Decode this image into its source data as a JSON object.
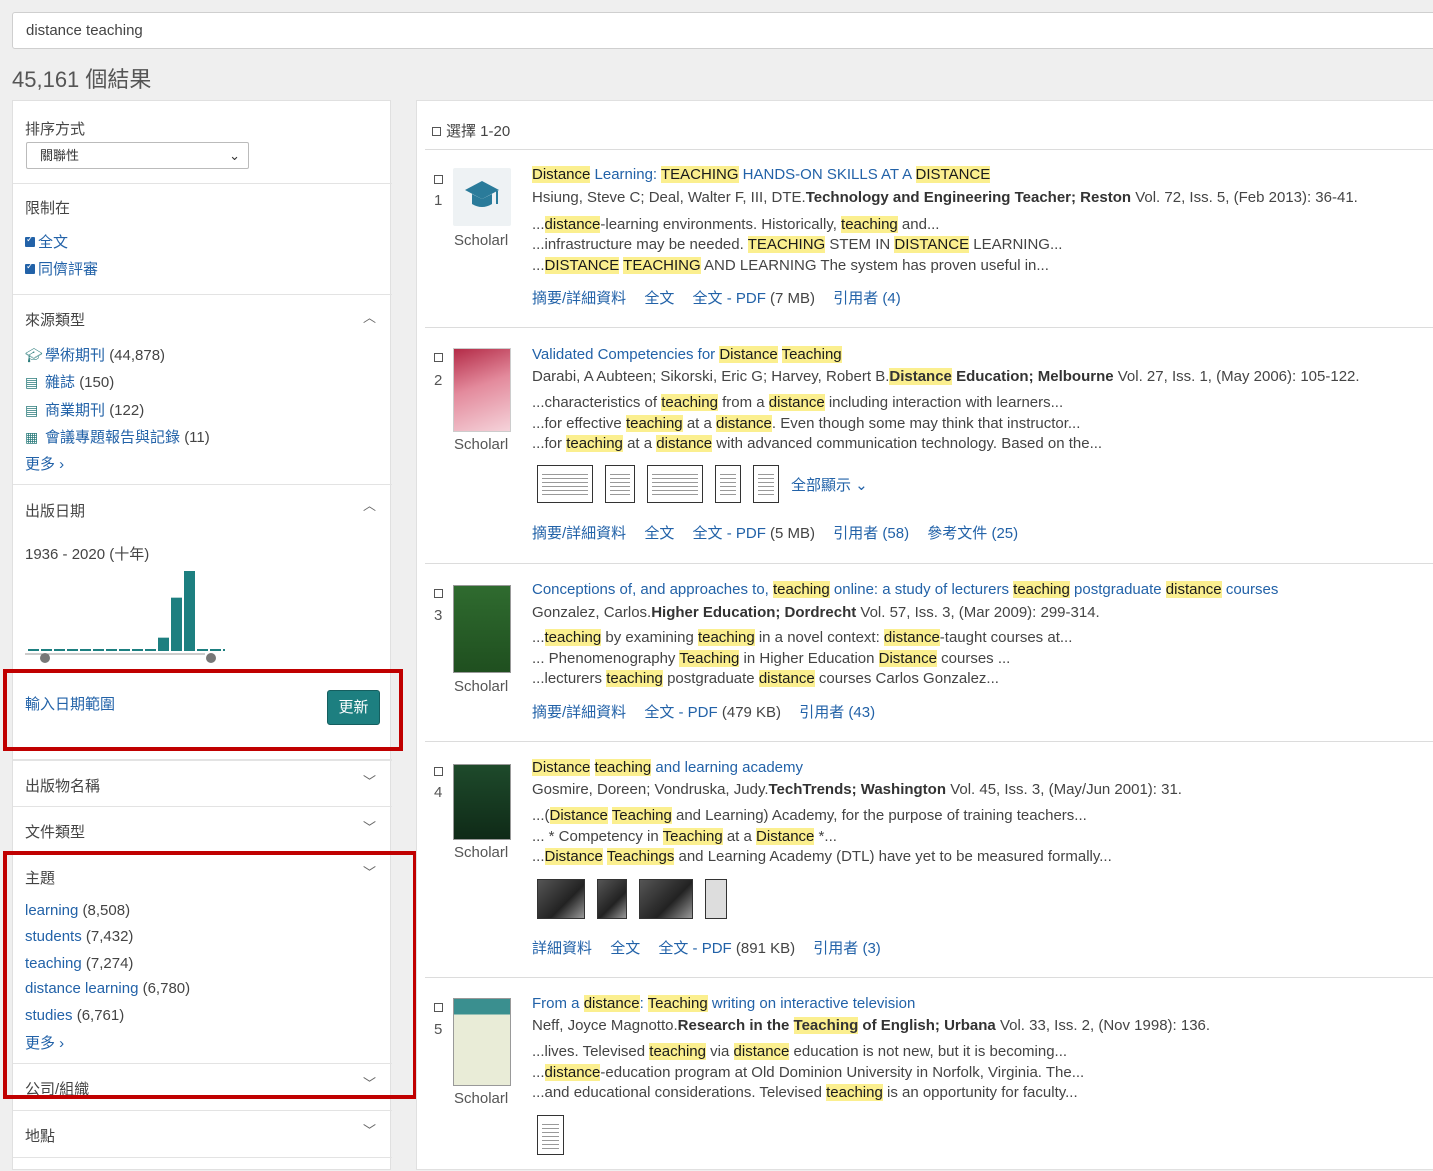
{
  "search": {
    "query": "distance teaching"
  },
  "result_count": "45,161 個結果",
  "sidebar": {
    "sort_title": "排序方式",
    "sort_value": "關聯性",
    "limit_title": "限制在",
    "limit_items": [
      "全文",
      "同儕評審"
    ],
    "source_type_title": "來源類型",
    "source_types": [
      {
        "label": "學術期刊",
        "count": "(44,878)",
        "icon": "graduation-cap-icon"
      },
      {
        "label": "雜誌",
        "count": "(150)",
        "icon": "magazine-icon"
      },
      {
        "label": "商業期刊",
        "count": "(122)",
        "icon": "trade-journal-icon"
      },
      {
        "label": "會議專題報告與記錄",
        "count": "(11)",
        "icon": "conference-icon"
      }
    ],
    "more_label": "更多 ›",
    "pub_date_title": "出版日期",
    "pub_date_range": "1936 - 2020 (十年)",
    "histogram_values": [
      1,
      1,
      1,
      1,
      1,
      1,
      1,
      1,
      1,
      1,
      10,
      40,
      60,
      1,
      1,
      1
    ],
    "enter_date_range": "輸入日期範圍",
    "update_button": "更新",
    "publication_title": "出版物名稱",
    "doc_type_title": "文件類型",
    "subject_title": "主題",
    "subjects": [
      {
        "label": "learning",
        "count": "(8,508)"
      },
      {
        "label": "students",
        "count": "(7,432)"
      },
      {
        "label": "teaching",
        "count": "(7,274)"
      },
      {
        "label": "distance learning",
        "count": "(6,780)"
      },
      {
        "label": "studies",
        "count": "(6,761)"
      }
    ],
    "company_title": "公司/組織",
    "location_title": "地點"
  },
  "results": {
    "select_label": "選擇 1-20",
    "scholarly_label": "Scholarl",
    "items": [
      {
        "num": "1",
        "authors": "Hsiung, Steve C; Deal, Walter F, III, DTE.",
        "publication": "Technology and Engineering Teacher; Reston",
        "details": "Vol. 72, Iss. 5,  (Feb 2013): 36-41.",
        "links": [
          "摘要/詳細資料",
          "全文",
          "全文 - PDF",
          "(7 MB)",
          "引用者",
          "(4)"
        ]
      },
      {
        "num": "2",
        "authors": "Darabi, A Aubteen; Sikorski, Eric G; Harvey, Robert B.",
        "publication": "Distance Education; Melbourne",
        "details": "Vol. 27, Iss. 1,  (May 2006): 105-122.",
        "show_all": "全部顯示 ⌄",
        "links": [
          "摘要/詳細資料",
          "全文",
          "全文 - PDF",
          "(5 MB)",
          "引用者",
          "(58)",
          "參考文件",
          "(25)"
        ]
      },
      {
        "num": "3",
        "authors": "Gonzalez, Carlos.",
        "publication": "Higher Education; Dordrecht",
        "details": "Vol. 57, Iss. 3,  (Mar 2009): 299-314.",
        "links": [
          "摘要/詳細資料",
          "全文 - PDF",
          "(479 KB)",
          "引用者",
          "(43)"
        ]
      },
      {
        "num": "4",
        "authors": "Gosmire, Doreen; Vondruska, Judy.",
        "publication": "TechTrends; Washington",
        "details": "Vol. 45, Iss. 3,  (May/Jun 2001): 31.",
        "links": [
          "詳細資料",
          "全文",
          "全文 - PDF",
          "(891 KB)",
          "引用者",
          "(3)"
        ]
      },
      {
        "num": "5",
        "authors": "Neff, Joyce Magnotto.",
        "publication_pre": "Research in the ",
        "publication_hl": "Teaching",
        "publication_post": " of English; Urbana",
        "details": "Vol. 33, Iss. 2,  (Nov 1998): 136."
      }
    ]
  },
  "colors": {
    "accent": "#1d7f80",
    "link": "#2262a8",
    "highlight": "#fbef8f",
    "annotation": "#c00000"
  }
}
